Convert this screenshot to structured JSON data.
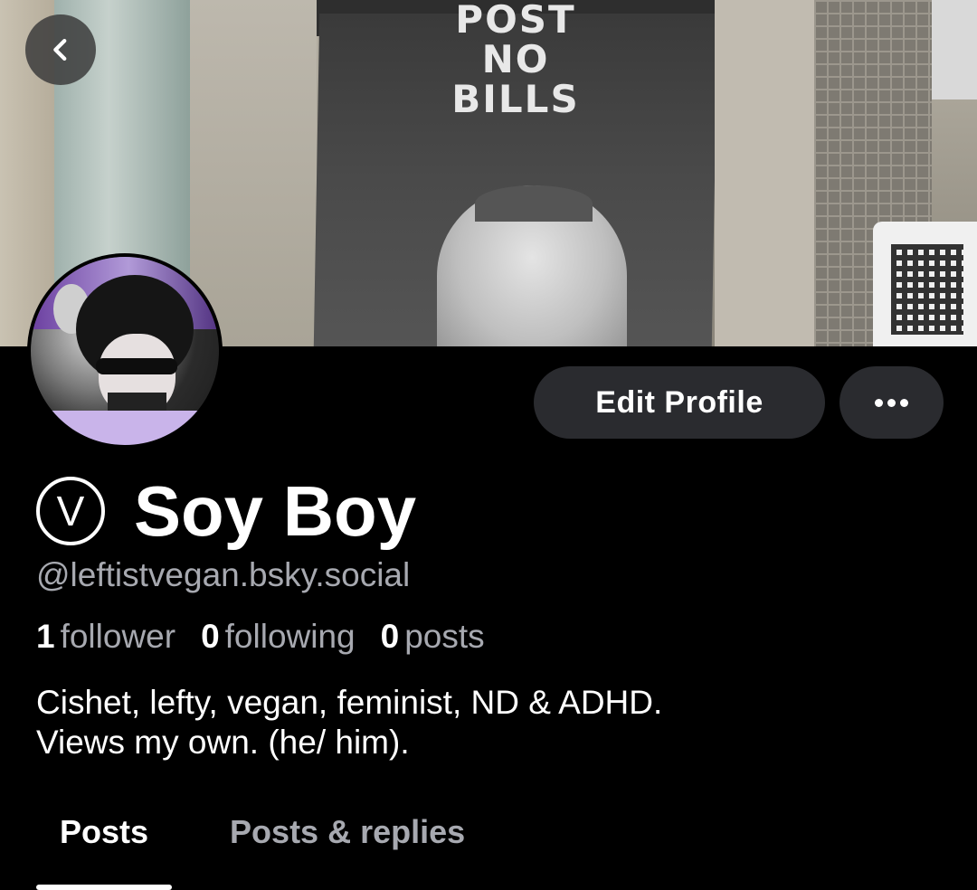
{
  "header": {
    "back_icon": "chevron-left-icon"
  },
  "banner": {
    "poster_text": [
      "POST",
      "NO",
      "BILLS"
    ]
  },
  "profile": {
    "edit_button_label": "Edit Profile",
    "more_icon": "ellipsis-icon",
    "vegan_symbol": "V",
    "display_name": "Soy Boy",
    "handle": "@leftistvegan.bsky.social",
    "stats": {
      "followers_count": "1",
      "followers_label": "follower",
      "following_count": "0",
      "following_label": "following",
      "posts_count": "0",
      "posts_label": "posts"
    },
    "bio": {
      "line1": "Cishet, lefty, vegan, feminist, ND & ADHD.",
      "line2": "Views my own. (he/ him)."
    }
  },
  "tabs": [
    {
      "label": "Posts",
      "active": true
    },
    {
      "label": "Posts & replies",
      "active": false
    }
  ],
  "colors": {
    "background": "#000000",
    "button_bg": "#2a2b2f",
    "muted_text": "#a7a9b0",
    "text": "#ffffff"
  }
}
